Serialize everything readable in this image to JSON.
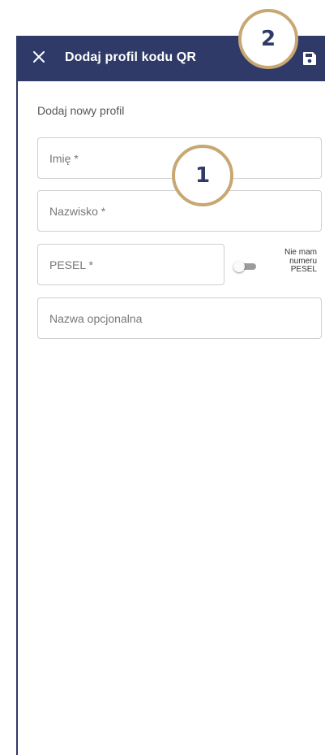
{
  "appbar": {
    "title": "Dodaj profil kodu QR",
    "close_icon": "close-icon",
    "save_icon": "save-icon"
  },
  "form": {
    "section_label": "Dodaj nowy profil",
    "first_name_placeholder": "Imię *",
    "last_name_placeholder": "Nazwisko *",
    "pesel_placeholder": "PESEL *",
    "optional_name_placeholder": "Nazwa opcjonalna",
    "no_pesel_label_1": "Nie mam",
    "no_pesel_label_2": "numeru",
    "no_pesel_label_3": "PESEL",
    "no_pesel_toggle_on": false
  },
  "annotations": {
    "badge_1": "1",
    "badge_2": "2"
  },
  "colors": {
    "appbar": "#2f3a68",
    "badge_border": "#c8a872",
    "badge_text": "#2f3a68"
  }
}
